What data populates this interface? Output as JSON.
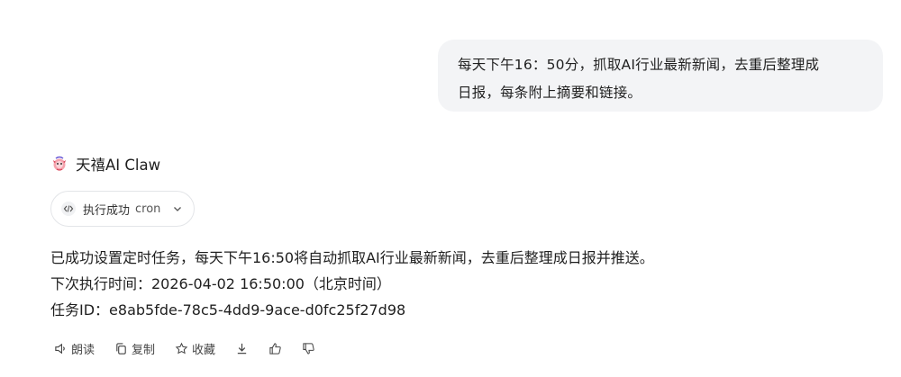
{
  "user_message": {
    "line1": "每天下午16：50分，抓取AI行业最新新闻，去重后整理成",
    "line2": "日报，每条附上摘要和链接。"
  },
  "assistant": {
    "name": "天禧AI Claw",
    "avatar_icon": "claw-mascot-icon"
  },
  "execution": {
    "status": "执行成功",
    "command": "cron"
  },
  "response": {
    "line1": "已成功设置定时任务，每天下午16:50将自动抓取AI行业最新新闻，去重后整理成日报并推送。",
    "line2": "下次执行时间：2026-04-02 16:50:00（北京时间）",
    "line3": "任务ID：e8ab5fde-78c5-4dd9-9ace-d0fc25f27d98"
  },
  "actions": {
    "read_aloud": "朗读",
    "copy": "复制",
    "favorite": "收藏"
  },
  "colors": {
    "bubble_bg": "#f3f4f6",
    "text": "#1f1f1f",
    "pill_border": "#e3e5e8"
  }
}
